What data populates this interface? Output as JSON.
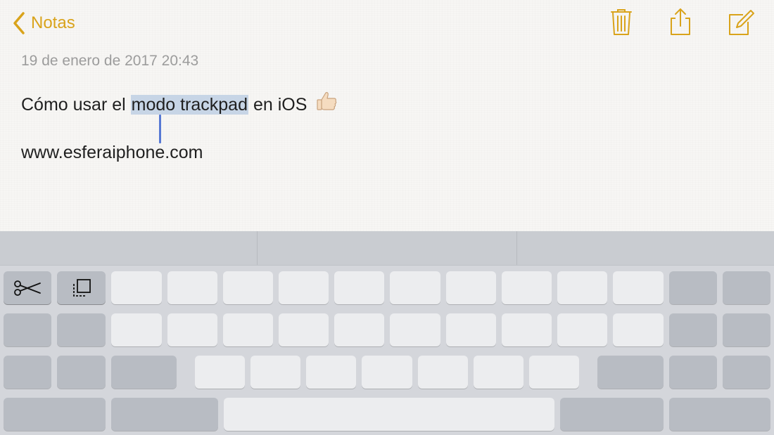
{
  "nav": {
    "back_label": "Notas",
    "icons": [
      "chevron-left-icon",
      "trash-icon",
      "share-icon",
      "compose-icon"
    ],
    "accent_color": "#d9a31b"
  },
  "note": {
    "date": "19 de enero de 2017 20:43",
    "text_before": "Cómo usar el ",
    "selected_text": "modo trackpad",
    "text_after": " en iOS",
    "emoji_icon": "thumbs-up-icon",
    "url_line": "www.esferaiphone.com",
    "selection_color": "#c7d5e6",
    "cursor_color": "#5779d4"
  },
  "keyboard": {
    "mode": "trackpad",
    "tools": [
      "scissors-icon",
      "copy-icon"
    ]
  }
}
